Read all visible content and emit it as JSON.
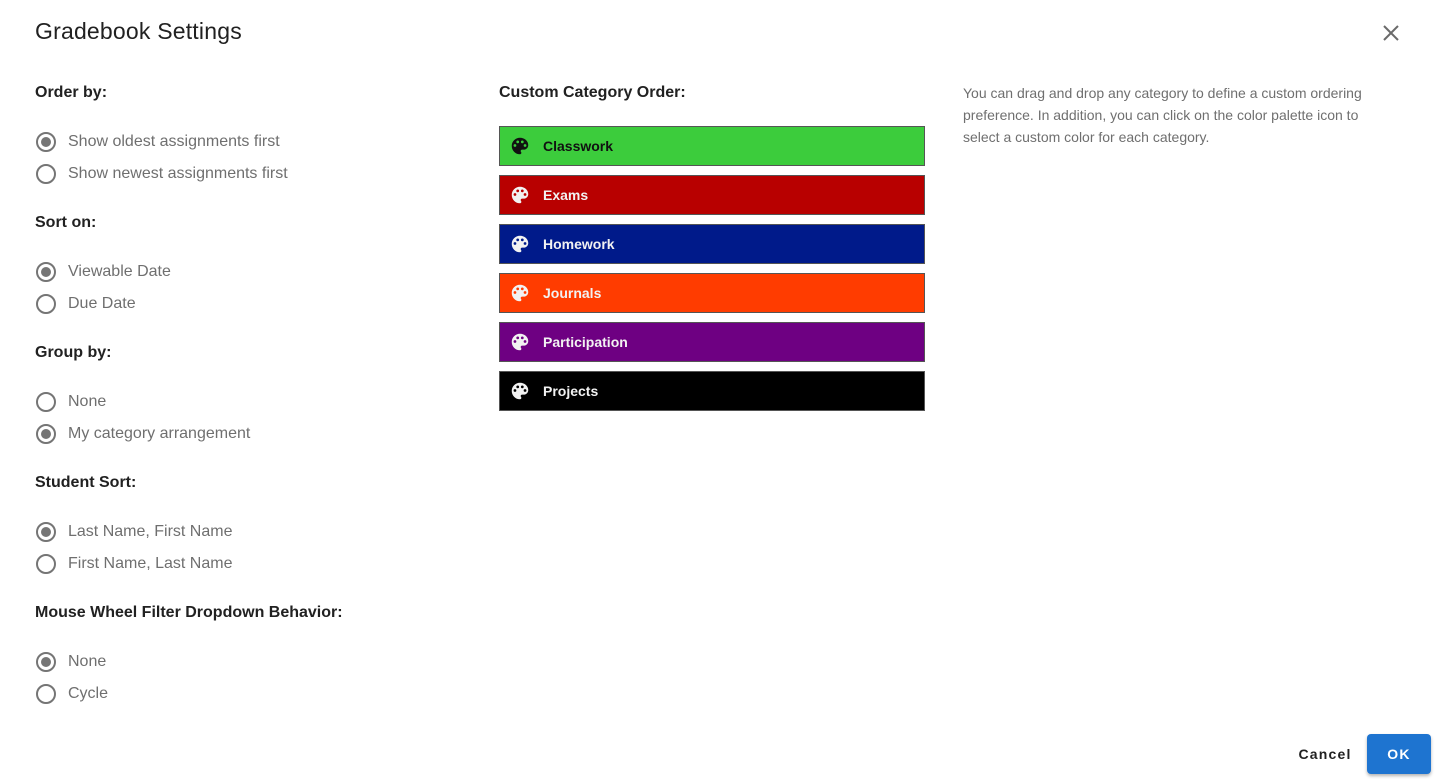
{
  "dialog": {
    "title": "Gradebook Settings",
    "close_icon": "close-icon"
  },
  "sections": [
    {
      "label": "Order by:",
      "options": [
        {
          "label": "Show oldest assignments first",
          "checked": true
        },
        {
          "label": "Show newest assignments first",
          "checked": false
        }
      ]
    },
    {
      "label": "Sort on:",
      "options": [
        {
          "label": "Viewable Date",
          "checked": true
        },
        {
          "label": "Due Date",
          "checked": false
        }
      ]
    },
    {
      "label": "Group by:",
      "options": [
        {
          "label": "None",
          "checked": false
        },
        {
          "label": "My category arrangement",
          "checked": true
        }
      ]
    },
    {
      "label": "Student Sort:",
      "options": [
        {
          "label": "Last Name, First Name",
          "checked": true
        },
        {
          "label": "First Name, Last Name",
          "checked": false
        }
      ]
    },
    {
      "label": "Mouse Wheel Filter Dropdown Behavior:",
      "options": [
        {
          "label": "None",
          "checked": true
        },
        {
          "label": "Cycle",
          "checked": false
        }
      ]
    }
  ],
  "custom_order": {
    "label": "Custom Category Order:",
    "icon": "palette-icon",
    "categories": [
      {
        "name": "Classwork",
        "color": "#3ccc3c",
        "text_color": "#111111"
      },
      {
        "name": "Exams",
        "color": "#b80000",
        "text_color": "#f2f2f2"
      },
      {
        "name": "Homework",
        "color": "#001a8a",
        "text_color": "#f2f2f2"
      },
      {
        "name": "Journals",
        "color": "#ff3c00",
        "text_color": "#f2f2f2"
      },
      {
        "name": "Participation",
        "color": "#6e0082",
        "text_color": "#f2f2f2"
      },
      {
        "name": "Projects",
        "color": "#000000",
        "text_color": "#f2f2f2"
      }
    ]
  },
  "help_text": "You can drag and drop any category to define a custom ordering preference. In addition, you can click on the color palette icon to select a custom color for each category.",
  "footer": {
    "cancel_label": "Cancel",
    "ok_label": "OK",
    "ok_color": "#1e74d0"
  }
}
